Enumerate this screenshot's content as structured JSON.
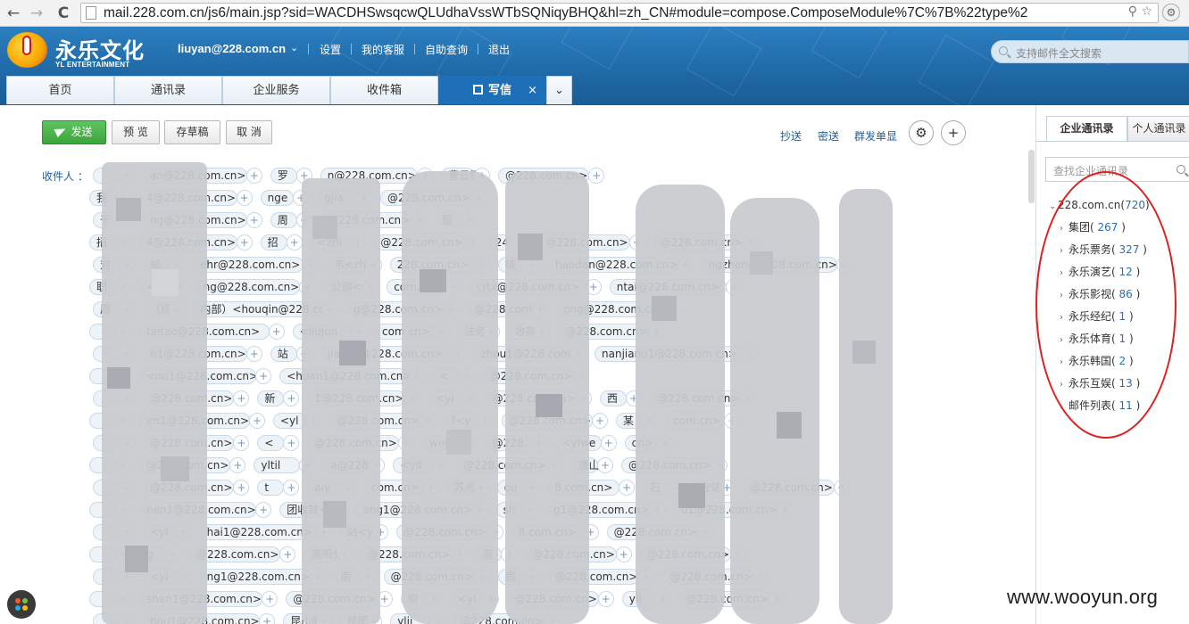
{
  "browser": {
    "url": "mail.228.com.cn/js6/main.jsp?sid=WACDHSwsqcwQLUdhaVssWTbSQNiqyBHQ&hl=zh_CN#module=compose.ComposeModule%7C%7B%22type%2",
    "back_glyph": "←",
    "forward_glyph": "→",
    "reload_glyph": "C",
    "url_right_glyphs": "⚲ ☆",
    "settings_glyph": "⚙"
  },
  "header": {
    "logo_cn": "永乐文化",
    "logo_en": "YL ENTERTAINMENT",
    "account": "liuyan@228.com.cn",
    "account_dropdown": "⌄",
    "links": [
      "设置",
      "我的客服",
      "自助查询",
      "退出"
    ],
    "search_placeholder": "支持邮件全文搜索"
  },
  "tabs": {
    "home": "首页",
    "contacts": "通讯录",
    "enterprise": "企业服务",
    "inbox": "收件箱",
    "compose": "写信",
    "compose_close": "×",
    "more": "⌄"
  },
  "toolbar": {
    "send": "发送",
    "preview": "预 览",
    "save_draft": "存草稿",
    "cancel": "取 消",
    "cc": "抄送",
    "bcc": "密送",
    "individual": "群发单显",
    "settings_glyph": "⚙",
    "add_contact_glyph": "+"
  },
  "compose": {
    "recipients_label": "收件人 ：",
    "plus": "+",
    "rows": [
      [
        "",
        "an@228.com.cn>",
        "罗",
        "n@228.com.cn>",
        "曹云扬",
        "@228.com.cn>"
      ],
      [
        "我",
        "4@228.com.cn>",
        "nge",
        "gjia",
        "@228.com.cn>"
      ],
      [
        "于",
        "ng@228.com.cn>",
        "周",
        "@228.com.cn>",
        "殷"
      ],
      [
        "招",
        "4@228.com.cn>",
        "招",
        "<zhi",
        "@228.com.cn>",
        "24",
        "@228.com.cn>",
        "@228.com.cn>"
      ],
      [
        "对",
        "邮",
        "ehr@228.com.cn>",
        "韦<zh",
        "228.com.cn>",
        "晓",
        "haodan@228.com.cn>",
        "ngzheng@228.com.cn>"
      ],
      [
        "职",
        "<xi",
        "ng@228.com.cn>",
        "公部<w",
        "com.cn>",
        "crtx@228.com.cn>",
        "ntai@228.com.cn>"
      ],
      [
        "周",
        "（综",
        "内部）<houqin@228.com",
        "g@228.com.cn>",
        "@228.com",
        "ong@228.com.cn>"
      ],
      [
        "",
        "taitao@228.com.cn>",
        "<liujun",
        "com.cn>",
        "法务",
        "收款",
        "@228.com.cn>"
      ],
      [
        "",
        "n1@228.com.cn>",
        "站",
        "jiang1@228.com.cn>",
        "zhou1@228.com",
        "nanjiang1@228.com.cn>"
      ],
      [
        "",
        "<ou1@228.com.cn>",
        "<huan1@228.com.cn>",
        "<",
        "@228.com.cn>"
      ],
      [
        "",
        "@228.com.cn>",
        "新",
        "1@228.com.cn>",
        "<yl",
        "@228.com.cn>",
        "西",
        "@228.com.cn>"
      ],
      [
        "",
        "en1@228.com.cn>",
        "<yl",
        "@228.com.cn>",
        "f<y",
        "@228.com.cn>",
        "某",
        "com.cn>"
      ],
      [
        "",
        "@228.com.cn>",
        "<",
        "@228.com.cn>",
        "weil",
        "@228.",
        "<ylwe",
        "cn>"
      ],
      [
        "",
        "@228.com.cn>",
        "yltil",
        "a@228",
        "<ylt",
        "@228.com.cn>",
        "唐山",
        "@228.com.cn>"
      ],
      [
        "",
        "@228.com.cn>",
        "t",
        "aiy",
        "com.cn>",
        "苏州",
        "ou",
        "8.com.cn>",
        "石",
        "分站",
        "@228.com.cn>"
      ],
      [
        "",
        "nen1@228.com.cn>",
        "团收款<yl",
        "ang1@228.com.cn>",
        "sh",
        "g1@228.com.cn>",
        "u1@228.com.cn>"
      ],
      [
        "",
        "<yl",
        "hai1@228.com.cn>",
        "站<y",
        "@228.com.cn>",
        "8.com.cn>",
        "@228.com.cn>"
      ],
      [
        "",
        "g",
        "@228.com.cn>",
        "南阳分",
        "@228.com.cn>",
        "南",
        "@228.com.cn>",
        "@228.com.cn>"
      ],
      [
        "",
        "<yl",
        "ng1@228.com.cn>",
        "南",
        "@228.com.cn>",
        "南",
        "@228.com.cn>",
        "@228.com.cn>"
      ],
      [
        "",
        "shan1@228.com.cn>",
        "@228.com.cn>",
        "柳",
        "<yl",
        "@228.com.cn>",
        "yli",
        "@228.com.cn>"
      ],
      [
        "",
        "hou1@228.com.cn>",
        "昆山收",
        "昆明",
        "ylji",
        "@228.com.cn>"
      ]
    ]
  },
  "contacts_panel": {
    "tab_enterprise": "企业通讯录",
    "tab_personal": "个人通讯录",
    "search_placeholder": "查找企业通讯录",
    "tree": {
      "root": {
        "name": "228.com.cn",
        "count": "720"
      },
      "items": [
        {
          "name": "集团",
          "count": "267"
        },
        {
          "name": "永乐票务",
          "count": "327"
        },
        {
          "name": "永乐演艺",
          "count": "12"
        },
        {
          "name": "永乐影视",
          "count": "86"
        },
        {
          "name": "永乐经纪",
          "count": "1"
        },
        {
          "name": "永乐体育",
          "count": "1"
        },
        {
          "name": "永乐韩国",
          "count": "2"
        },
        {
          "name": "永乐互娱",
          "count": "13"
        },
        {
          "name": "邮件列表",
          "count": "11"
        }
      ]
    }
  },
  "watermark": "www.wooyun.org",
  "colors": {
    "header_blue": "#1f6aa8",
    "active_tab": "#1d6fb8",
    "send_green": "#3ba53b",
    "link_blue": "#1d5e9c",
    "count_blue": "#2a6fb0",
    "annotation_red": "#e02020"
  }
}
